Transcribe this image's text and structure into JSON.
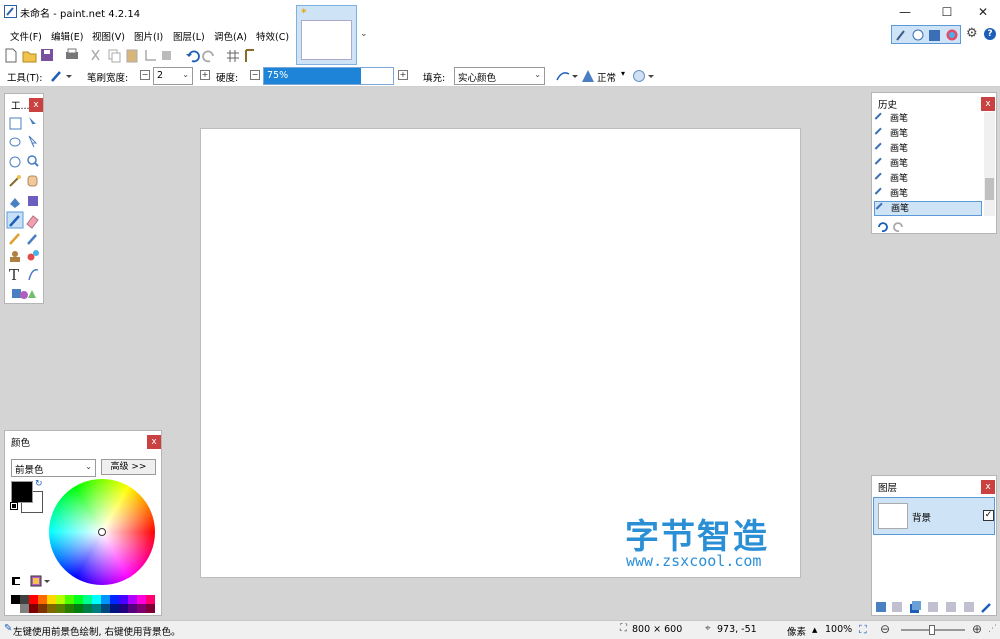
{
  "window": {
    "title": "未命名 - paint.net 4.2.14",
    "minimize": "—",
    "maximize": "☐",
    "close": "✕"
  },
  "menu": {
    "items": [
      "文件(F)",
      "编辑(E)",
      "视图(V)",
      "图片(I)",
      "图层(L)",
      "调色(A)",
      "特效(C)"
    ],
    "doc_tab_star": "✶"
  },
  "toolbar": {
    "tool_label": "工具(T):",
    "brush_width_label": "笔刷宽度:",
    "brush_width_value": "2",
    "hardness_label": "硬度:",
    "hardness_value": "75%",
    "hardness_fraction": 0.75,
    "fill_label": "填充:",
    "fill_value": "实心颜色",
    "blend_mode": "正常"
  },
  "tools_panel": {
    "title": "工...",
    "close": "x"
  },
  "history_panel": {
    "title": "历史",
    "close": "x",
    "items": [
      "画笔",
      "画笔",
      "画笔",
      "画笔",
      "画笔",
      "画笔",
      "画笔"
    ],
    "selected_index": 6
  },
  "colors_panel": {
    "title": "颜色",
    "close": "x",
    "mode": "前景色",
    "advanced": "高级 >>",
    "primary_color": "#000000",
    "secondary_color": "#ffffff",
    "palette": [
      "#000000",
      "#404040",
      "#ff0000",
      "#ff6a00",
      "#ffd800",
      "#b6ff00",
      "#4cff00",
      "#00ff21",
      "#00ff90",
      "#00ffff",
      "#0094ff",
      "#0026ff",
      "#4800ff",
      "#b200ff",
      "#ff00dc",
      "#ff006e",
      "#ffffff",
      "#808080",
      "#7f0000",
      "#7f3300",
      "#7f6a00",
      "#5b7f00",
      "#267f00",
      "#007f0e",
      "#007f46",
      "#007f7f",
      "#004a7f",
      "#00137f",
      "#21007f",
      "#57007f",
      "#7f006e",
      "#7f0037"
    ]
  },
  "layers_panel": {
    "title": "图层",
    "close": "x",
    "layer_name": "背景",
    "layer_visible": true
  },
  "watermark": {
    "name": "字节智造",
    "url": "www.zsxcool.com"
  },
  "status": {
    "hint": "左键使用前景色绘制, 右键使用背景色。",
    "image_size": "800 × 600",
    "cursor_pos": "973, -51",
    "units": "像素",
    "zoom": "100%"
  }
}
